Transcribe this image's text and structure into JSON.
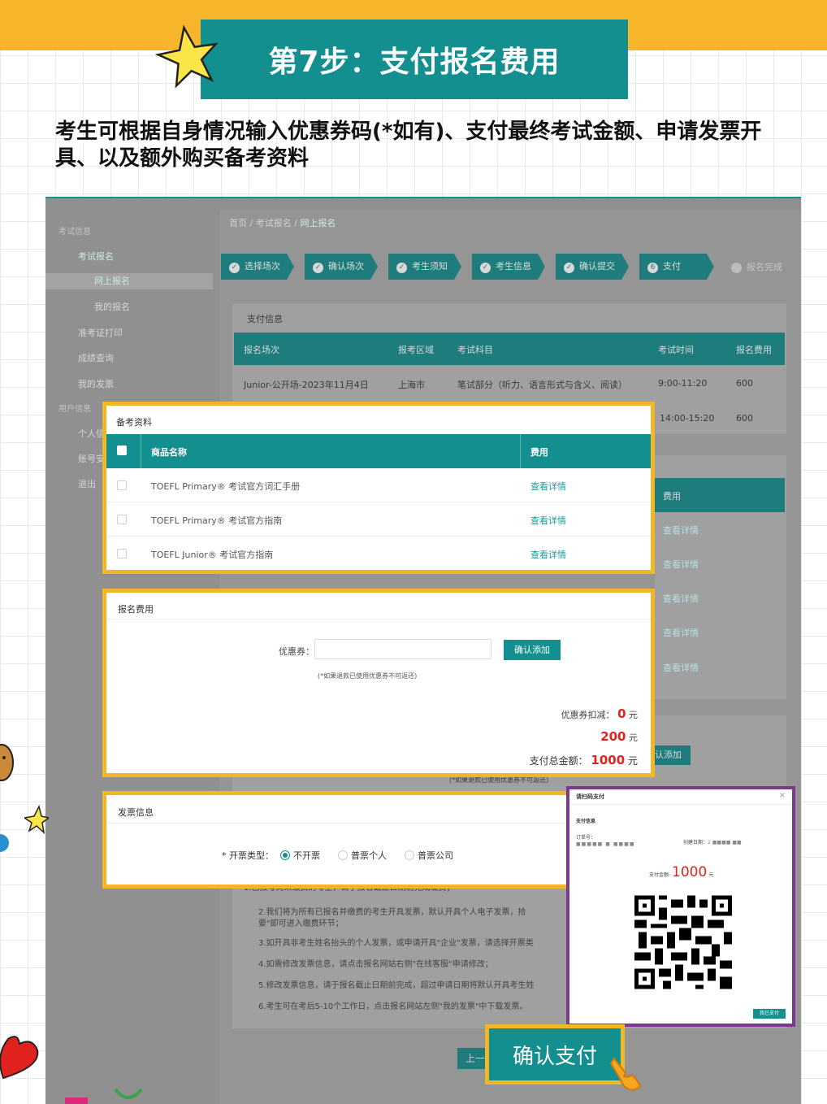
{
  "banner": {
    "title": "第7步：支付报名费用"
  },
  "intro": "考生可根据自身情况输入优惠券码(*如有)、支付最终考试金额、申请发票开具、以及额外购买备考资料",
  "sidebar": {
    "group1": "考试信息",
    "items": [
      "考试报名",
      "网上报名",
      "我的报名",
      "准考证打印",
      "成绩查询",
      "我的发票"
    ],
    "group2": "用户信息",
    "items2": [
      "个人信",
      "账号安",
      "退出"
    ]
  },
  "breadcrumb": {
    "home": "首页",
    "sep": "/",
    "level2": "考试报名",
    "current": "网上报名"
  },
  "steps": [
    "选择场次",
    "确认场次",
    "考生须知",
    "考生信息",
    "确认提交",
    "支付",
    "报名完成"
  ],
  "step_active_num": "6",
  "payinfo": {
    "title": "支付信息",
    "headers": [
      "报名场次",
      "报考区域",
      "考试科目",
      "考试时间",
      "报名费用"
    ],
    "rows": [
      [
        "Junior-公开场-2023年11月4日",
        "上海市",
        "笔试部分（听力、语言形式与含义、阅读）",
        "9:00-11:20",
        "600"
      ],
      [
        "",
        "",
        "",
        "14:00-15:20",
        "600"
      ]
    ]
  },
  "bg_fee_header": "费用",
  "bg_links": [
    "查看详情",
    "查看详情",
    "查看详情",
    "查看详情",
    "查看详情"
  ],
  "bg_add_btn": "认添加",
  "bg_note": "(*如果退款已使用优惠券不可返还)",
  "bg_notices": [
    "1.已报考尚未缴费的考生，请于报名截止日期前完成缴费；",
    "2.我们将为所有已报名并缴费的考生开具发票，默认开具个人电子发票，拾",
    "要\"即可进入缴费环节；",
    "3.如开具非考生姓名抬头的个人发票，或申请开具\"企业\"发票，请选择开票类",
    "4.如需修改发票信息，请点击报名网站右侧\"在线客服\"申请修改；",
    "5.修改发票信息，请于报名截止日期前完成，超过申请日期将默认开具考生姓",
    "6.考生可在考后5-10个工作日，点击报名网站左侧\"我的发票\"中下载发票。"
  ],
  "bg_prev": "上一",
  "materials": {
    "title": "备考资料",
    "col_name": "商品名称",
    "col_fee": "费用",
    "rows": [
      {
        "name": "TOEFL Primary® 考试官方词汇手册",
        "link": "查看详情"
      },
      {
        "name": "TOEFL Primary® 考试官方指南",
        "link": "查看详情"
      },
      {
        "name": "TOEFL Junior® 考试官方指南",
        "link": "查看详情"
      }
    ]
  },
  "fee": {
    "title": "报名费用",
    "coupon_label": "优惠券：",
    "coupon_value": "",
    "coupon_placeholder": "",
    "add_button": "确认添加",
    "note": "(*如果退款已使用优惠券不可返还)",
    "discount_label": "优惠券扣减：",
    "discount_value": "0",
    "unit": "元",
    "subtotal_value": "200",
    "total_label": "支付总金额：",
    "total_value": "1000"
  },
  "invoice": {
    "title": "发票信息",
    "type_label": "* 开票类型：",
    "options": [
      "不开票",
      "普票个人",
      "普票公司"
    ],
    "selected": "不开票"
  },
  "qr": {
    "title": "请扫码支付",
    "close": "×",
    "section": "支付信息",
    "order_label": "订单号：",
    "order_value": "■■■■■ ■ ■■■■",
    "created_label": "创建日期：",
    "created_value": "2 ■■■■ ■■",
    "amount_label": "支付金额:",
    "amount_value": "1000",
    "amount_unit": "元",
    "done_button": "我已支付"
  },
  "confirm_button": "确认支付",
  "colors": {
    "teal": "#138f8f",
    "orange": "#f6b52a",
    "highlight": "#f2b727",
    "purple": "#7a3b8f",
    "red": "#e0231f"
  }
}
